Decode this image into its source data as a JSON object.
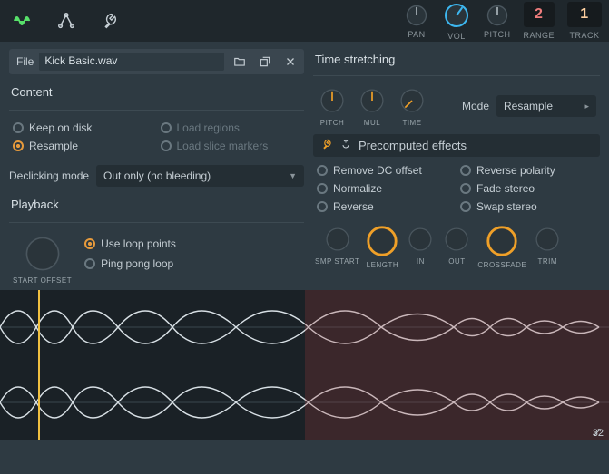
{
  "top": {
    "pan": "PAN",
    "vol": "VOL",
    "pitch": "PITCH",
    "range": "RANGE",
    "track": "TRACK",
    "range_value": "2",
    "track_value": "1"
  },
  "file": {
    "label": "File",
    "name": "Kick Basic.wav"
  },
  "content": {
    "title": "Content",
    "keep": "Keep on disk",
    "load_regions": "Load regions",
    "resample": "Resample",
    "load_slice": "Load slice markers",
    "declicking_label": "Declicking mode",
    "declicking_value": "Out only (no bleeding)"
  },
  "playback": {
    "title": "Playback",
    "start_offset": "START OFFSET",
    "use_loop": "Use loop points",
    "ping_pong": "Ping pong loop"
  },
  "time_stretch": {
    "title": "Time stretching",
    "pitch": "PITCH",
    "mul": "MUL",
    "time": "TIME",
    "mode_label": "Mode",
    "mode_value": "Resample"
  },
  "fx": {
    "title": "Precomputed effects",
    "remove_dc": "Remove DC offset",
    "reverse_polarity": "Reverse polarity",
    "normalize": "Normalize",
    "fade_stereo": "Fade stereo",
    "reverse": "Reverse",
    "swap_stereo": "Swap stereo",
    "smp_start": "SMP START",
    "length": "LENGTH",
    "in": "IN",
    "out": "OUT",
    "crossfade": "CROSSFADE",
    "trim": "TRIM"
  },
  "waveform": {
    "zoom": "32"
  }
}
